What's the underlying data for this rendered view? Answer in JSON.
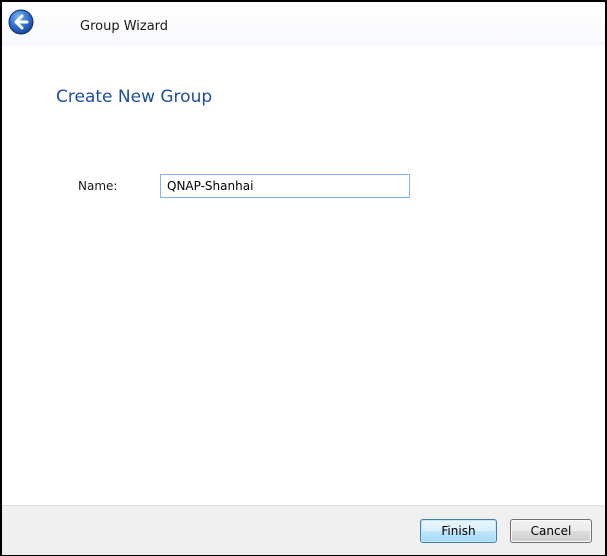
{
  "window": {
    "title": "Group Wizard"
  },
  "icons": {
    "back": "back-arrow-icon"
  },
  "page": {
    "heading": "Create New Group"
  },
  "form": {
    "name_label": "Name:",
    "name_value": "QNAP-Shanhai"
  },
  "footer": {
    "finish_label": "Finish",
    "cancel_label": "Cancel"
  },
  "colors": {
    "heading": "#1f4da0",
    "input_border": "#7eb4ea",
    "footer_bg": "#f0f0f0"
  }
}
